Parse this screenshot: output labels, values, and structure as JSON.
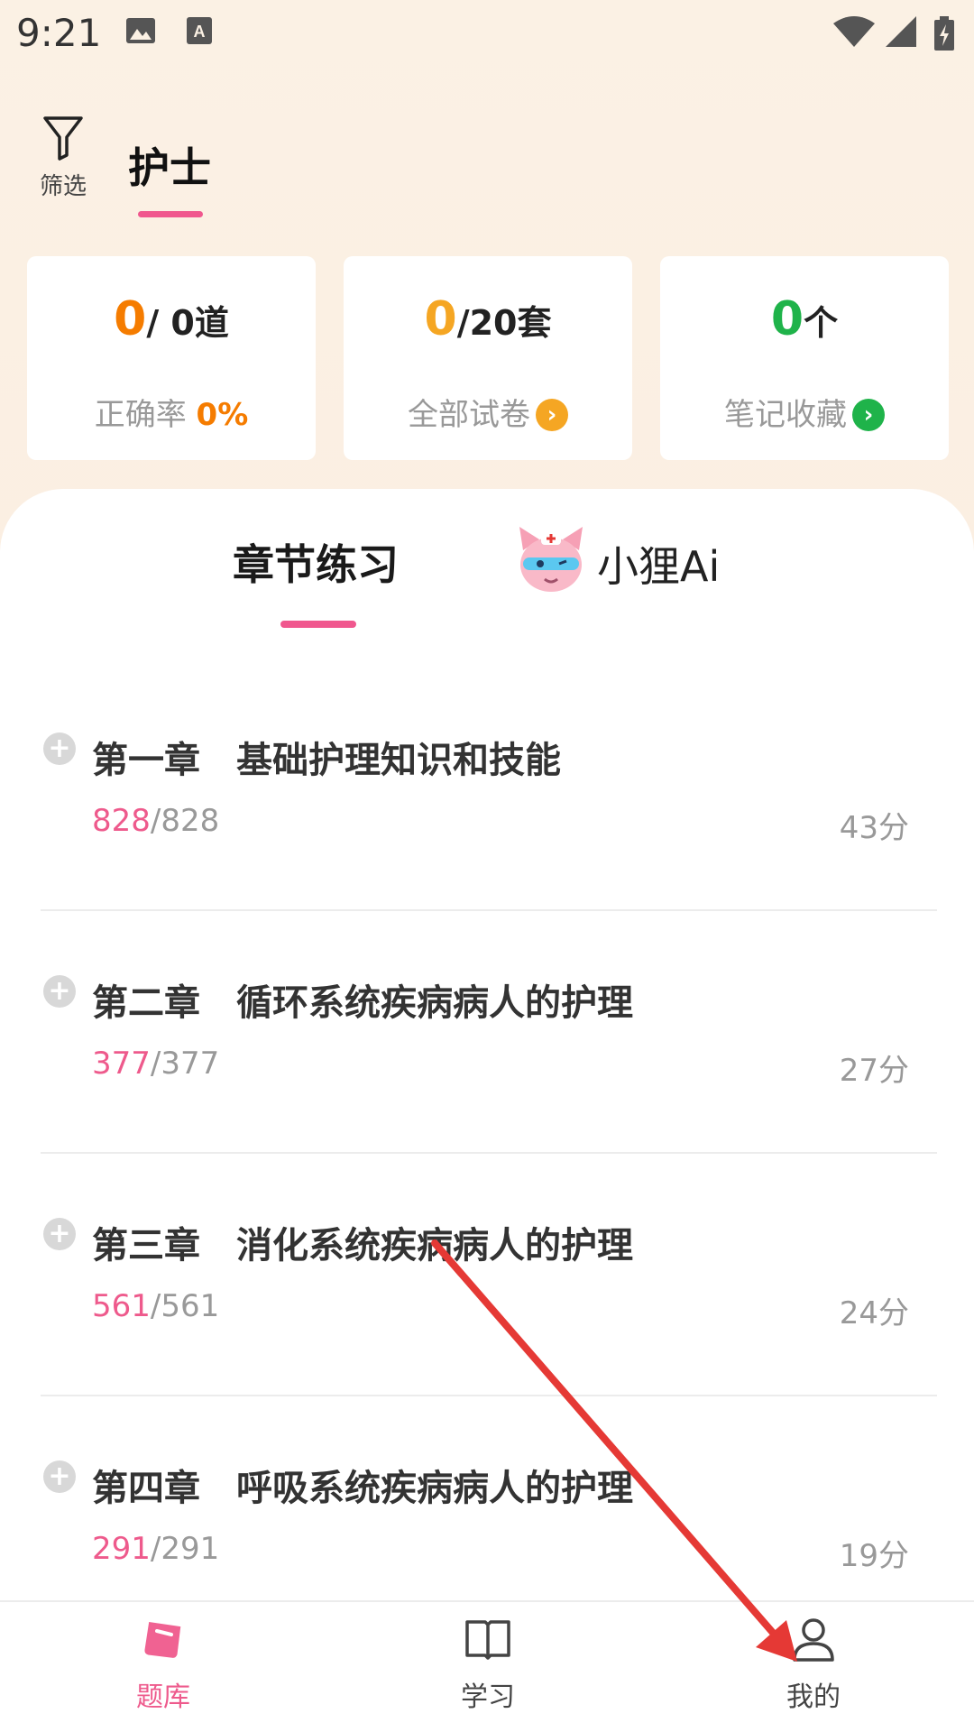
{
  "status_bar": {
    "time": "9:21"
  },
  "header": {
    "filter_label": "筛选",
    "title": "护士"
  },
  "stats": [
    {
      "value": "0",
      "unit": "/ 0道",
      "sub_label": "正确率",
      "sub_value": "0%",
      "accent": "#f57c00"
    },
    {
      "value": "0",
      "unit": "/20套",
      "sub_label": "全部试卷",
      "accent": "#f5a623"
    },
    {
      "value": "0",
      "unit": "个",
      "sub_label": "笔记收藏",
      "accent": "#1fb34a"
    }
  ],
  "tabs": {
    "chapter": "章节练习",
    "ai": "小狸Ai"
  },
  "chapters": [
    {
      "title": "第一章　基础护理知识和技能",
      "done": "828",
      "total": "/828",
      "score": "43分"
    },
    {
      "title": "第二章　循环系统疾病病人的护理",
      "done": "377",
      "total": "/377",
      "score": "27分"
    },
    {
      "title": "第三章　消化系统疾病病人的护理",
      "done": "561",
      "total": "/561",
      "score": "24分"
    },
    {
      "title": "第四章　呼吸系统疾病病人的护理",
      "done": "291",
      "total": "/291",
      "score": "19分"
    }
  ],
  "bottom_nav": {
    "items": [
      {
        "label": "题库",
        "icon": "question-bank-icon",
        "active": true
      },
      {
        "label": "学习",
        "icon": "book-icon",
        "active": false
      },
      {
        "label": "我的",
        "icon": "user-icon",
        "active": false
      }
    ]
  },
  "colors": {
    "accent_pink": "#f0578e",
    "progress_pink": "#ee5a8c",
    "annotation_red": "#e53935"
  }
}
